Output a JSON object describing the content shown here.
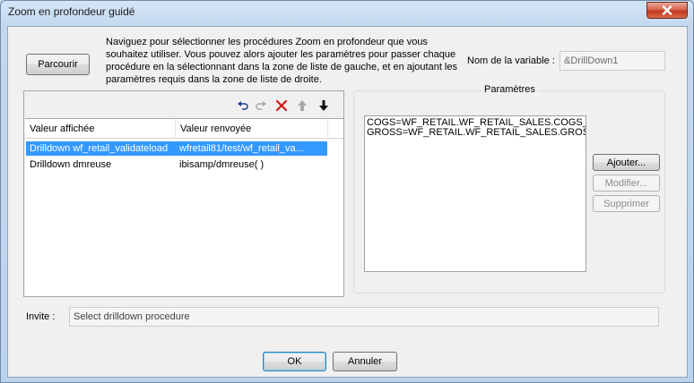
{
  "window": {
    "title": "Zoom en profondeur guidé"
  },
  "top": {
    "browse_label": "Parcourir",
    "description": "Naviguez pour sélectionner les procédures Zoom en profondeur que vous souhaitez utiliser. Vous pouvez alors ajouter les paramètres pour passer chaque procédure en la sélectionnant dans la zone de liste de gauche, et en ajoutant les paramètres requis dans la zone de liste de droite.",
    "variable_label": "Nom de la variable :",
    "variable_value": "&DrillDown1"
  },
  "toolbar": {
    "icons": [
      "undo-icon",
      "redo-icon",
      "delete-icon",
      "move-up-icon",
      "move-down-icon"
    ]
  },
  "list": {
    "columns": [
      "Valeur affichée",
      "Valeur renvoyée"
    ],
    "rows": [
      {
        "display": "Drilldown wf_retail_validateload",
        "returned": "wfretail81/test/wf_retail_va...",
        "selected": true
      },
      {
        "display": "Drilldown dmreuse",
        "returned": "ibisamp/dmreuse( )",
        "selected": false
      }
    ]
  },
  "parameters": {
    "title": "Paramètres",
    "lines": [
      "COGS=WF_RETAIL.WF_RETAIL_SALES.COGS_US",
      "GROSS=WF_RETAIL.WF_RETAIL_SALES.GROSS_F"
    ],
    "add_label": "Ajouter...",
    "modify_label": "Modifier...",
    "delete_label": "Supprimer"
  },
  "prompt": {
    "label": "Invite :",
    "value": "Select drilldown procedure"
  },
  "footer": {
    "ok_label": "OK",
    "cancel_label": "Annuler"
  },
  "colors": {
    "selection": "#3399ff",
    "delete_icon": "#d01818",
    "close_button": "#c8452c"
  }
}
